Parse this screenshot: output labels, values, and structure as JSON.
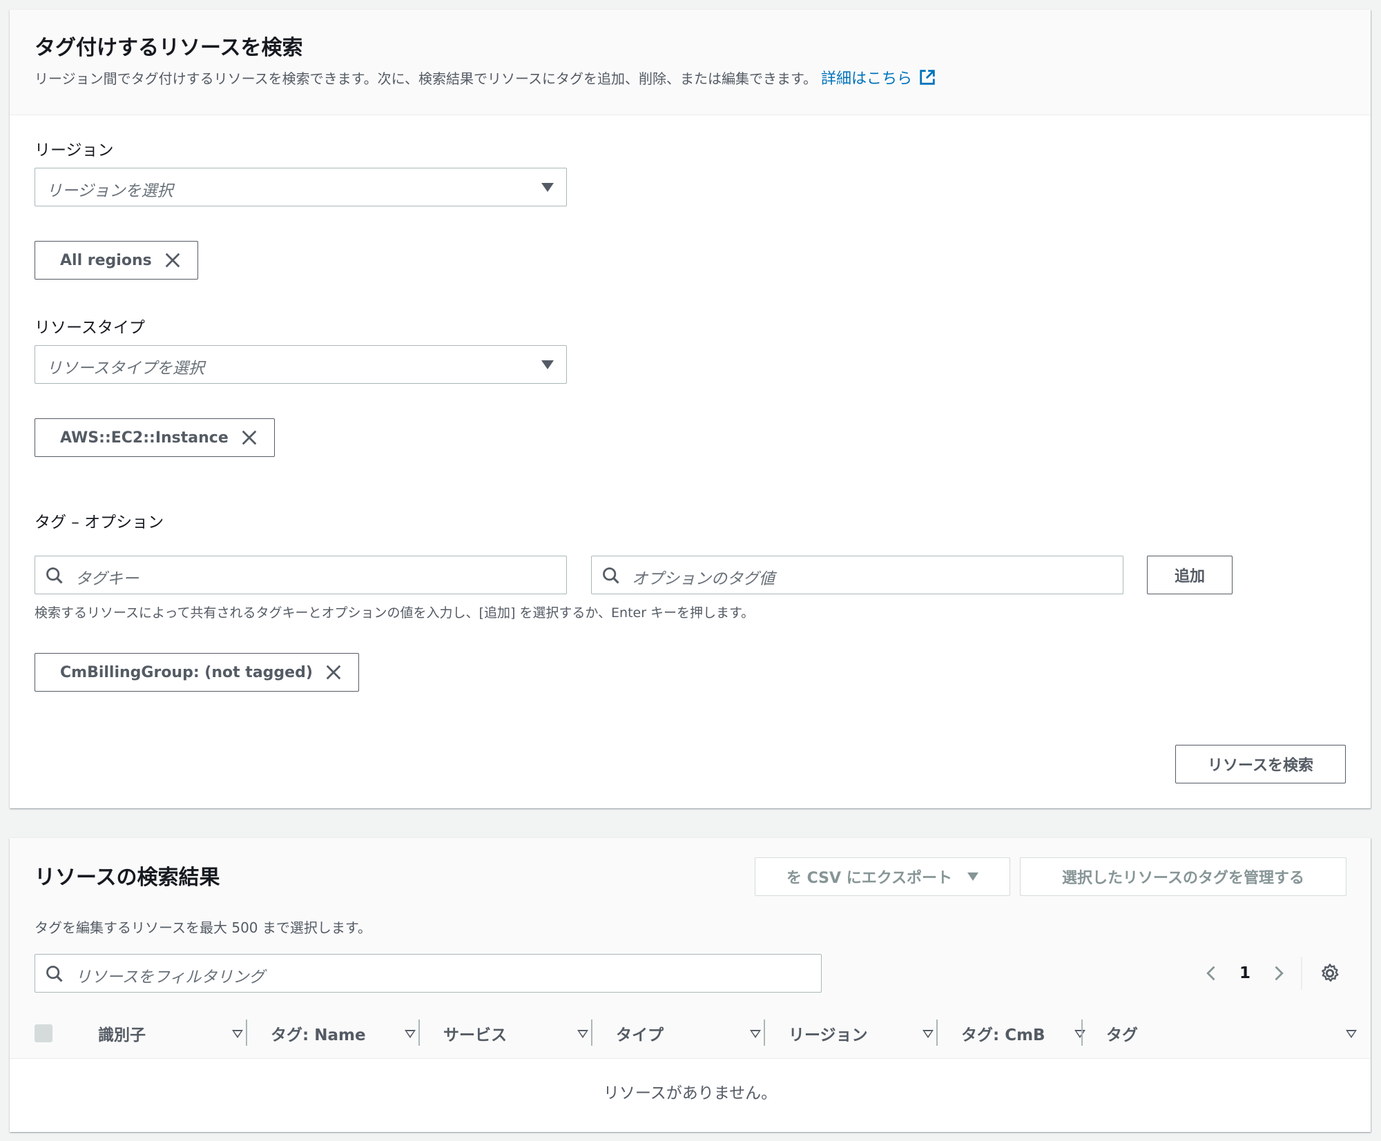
{
  "search_panel": {
    "title": "タグ付けするリソースを検索",
    "description": "リージョン間でタグ付けするリソースを検索できます。次に、検索結果でリソースにタグを追加、削除、または編集できます。",
    "learn_more": "詳細はこちら",
    "region": {
      "label": "リージョン",
      "placeholder": "リージョンを選択",
      "selected_token": "All regions"
    },
    "resource_type": {
      "label": "リソースタイプ",
      "placeholder": "リソースタイプを選択",
      "selected_token": "AWS::EC2::Instance"
    },
    "tags": {
      "label": "タグ – オプション",
      "key_placeholder": "タグキー",
      "value_placeholder": "オプションのタグ値",
      "add_button": "追加",
      "hint": "検索するリソースによって共有されるタグキーとオプションの値を入力し、[追加] を選択するか、Enter キーを押します。",
      "selected_token": "CmBillingGroup: (not tagged)"
    },
    "search_button": "リソースを検索"
  },
  "results_panel": {
    "title": "リソースの検索結果",
    "description": "タグを編集するリソースを最大 500 まで選択します。",
    "export_button": "を CSV にエクスポート",
    "manage_tags_button": "選択したリソースのタグを管理する",
    "filter_placeholder": "リソースをフィルタリング",
    "pagination": {
      "current_page": "1"
    },
    "columns": [
      "識別子",
      "タグ: Name",
      "サービス",
      "タイプ",
      "リージョン",
      "タグ: CmB",
      "タグ"
    ],
    "empty_message": "リソースがありません。"
  },
  "colors": {
    "link": "#0073bb",
    "text": "#16191f",
    "muted": "#545b64",
    "border": "#aab7b8"
  },
  "icons": [
    "external-link-icon",
    "close-icon",
    "search-icon",
    "chevron-left-icon",
    "chevron-right-icon",
    "gear-icon",
    "caret-down-icon"
  ]
}
